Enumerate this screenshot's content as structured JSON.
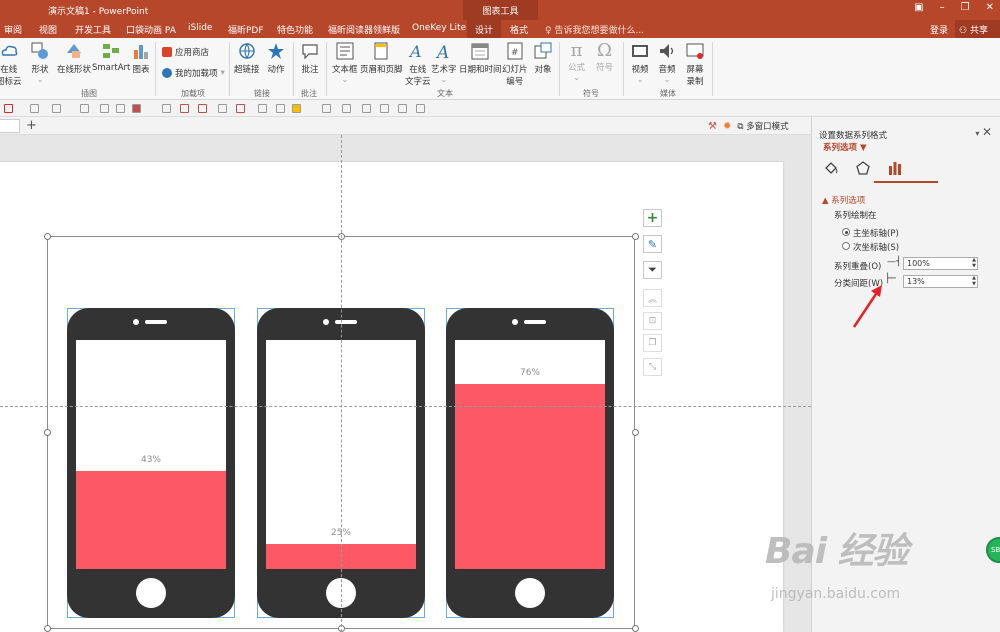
{
  "window": {
    "title": "演示文稿1 - PowerPoint",
    "contextual_group": "图表工具"
  },
  "tabs": [
    "审阅",
    "视图",
    "开发工具",
    "口袋动画 PA",
    "iSlide",
    "福昕PDF",
    "特色功能",
    "福昕阅读器领鲜版",
    "OneKey Lite",
    "设计",
    "格式"
  ],
  "tellme": "告诉我您想要做什么...",
  "account": {
    "login": "登录",
    "share": "共享"
  },
  "ribbon": {
    "groups": [
      "插图",
      "加载项",
      "链接",
      "批注",
      "文本",
      "符号",
      "媒体"
    ],
    "buttons": {
      "online_icon_1": "在线",
      "online_icon_2": "图标云",
      "shapes": "形状",
      "online_shapes": "在线形状",
      "smartart": "SmartArt",
      "chart": "图表",
      "app_store": "应用商店",
      "my_addins": "我的加载项",
      "hyperlink": "超链接",
      "action": "动作",
      "comment": "批注",
      "textbox": "文本框",
      "header_footer": "页眉和页脚",
      "online_text_1": "在线",
      "online_text_2": "文字云",
      "wordart": "艺术字",
      "datetime": "日期和时间",
      "slide_num_1": "幻灯片",
      "slide_num_2": "编号",
      "object": "对象",
      "equation": "公式",
      "symbol": "符号",
      "video": "视频",
      "audio": "音频",
      "screen_rec_1": "屏幕",
      "screen_rec_2": "录制"
    }
  },
  "slidebar": {
    "plus": "+",
    "multiwindow": "多窗口模式"
  },
  "phones": [
    {
      "percent_label": "43%",
      "fill": 0.43
    },
    {
      "percent_label": "25%",
      "fill": 0.11
    },
    {
      "percent_label": "76%",
      "fill": 0.81
    }
  ],
  "pane": {
    "title": "设置数据系列格式",
    "subtitle": "系列选项 ▼",
    "section": "▲ 系列选项",
    "plot_on": "系列绘制在",
    "primary_axis": "主坐标轴(P)",
    "secondary_axis": "次坐标轴(S)",
    "overlap_label": "系列重叠(O)",
    "overlap_value": "100%",
    "gap_label": "分类间距(W)",
    "gap_value": "13%"
  },
  "watermark": {
    "brand": "Bai 经验",
    "url": "jingyan.baidu.com"
  },
  "colors": {
    "accent": "#b7472a",
    "bar_fill": "#fc5865",
    "phone_body": "#333333",
    "arrow": "#e5212a"
  }
}
